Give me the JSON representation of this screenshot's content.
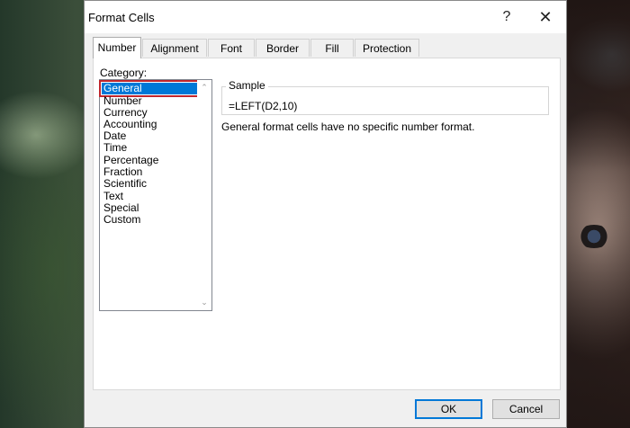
{
  "dialog": {
    "title": "Format Cells",
    "help": "?",
    "close": "✕"
  },
  "tabs": [
    {
      "label": "Number",
      "active": true
    },
    {
      "label": "Alignment",
      "active": false
    },
    {
      "label": "Font",
      "active": false
    },
    {
      "label": "Border",
      "active": false
    },
    {
      "label": "Fill",
      "active": false
    },
    {
      "label": "Protection",
      "active": false
    }
  ],
  "category": {
    "label": "Category:",
    "selected": "General",
    "items": [
      "General",
      "Number",
      "Currency",
      "Accounting",
      "Date",
      "Time",
      "Percentage",
      "Fraction",
      "Scientific",
      "Text",
      "Special",
      "Custom"
    ]
  },
  "sample": {
    "label": "Sample",
    "value": "=LEFT(D2,10)"
  },
  "description": "General format cells have no specific number format.",
  "buttons": {
    "ok": "OK",
    "cancel": "Cancel"
  },
  "colors": {
    "selection": "#0078d7",
    "highlight_outline": "#c0262d"
  }
}
